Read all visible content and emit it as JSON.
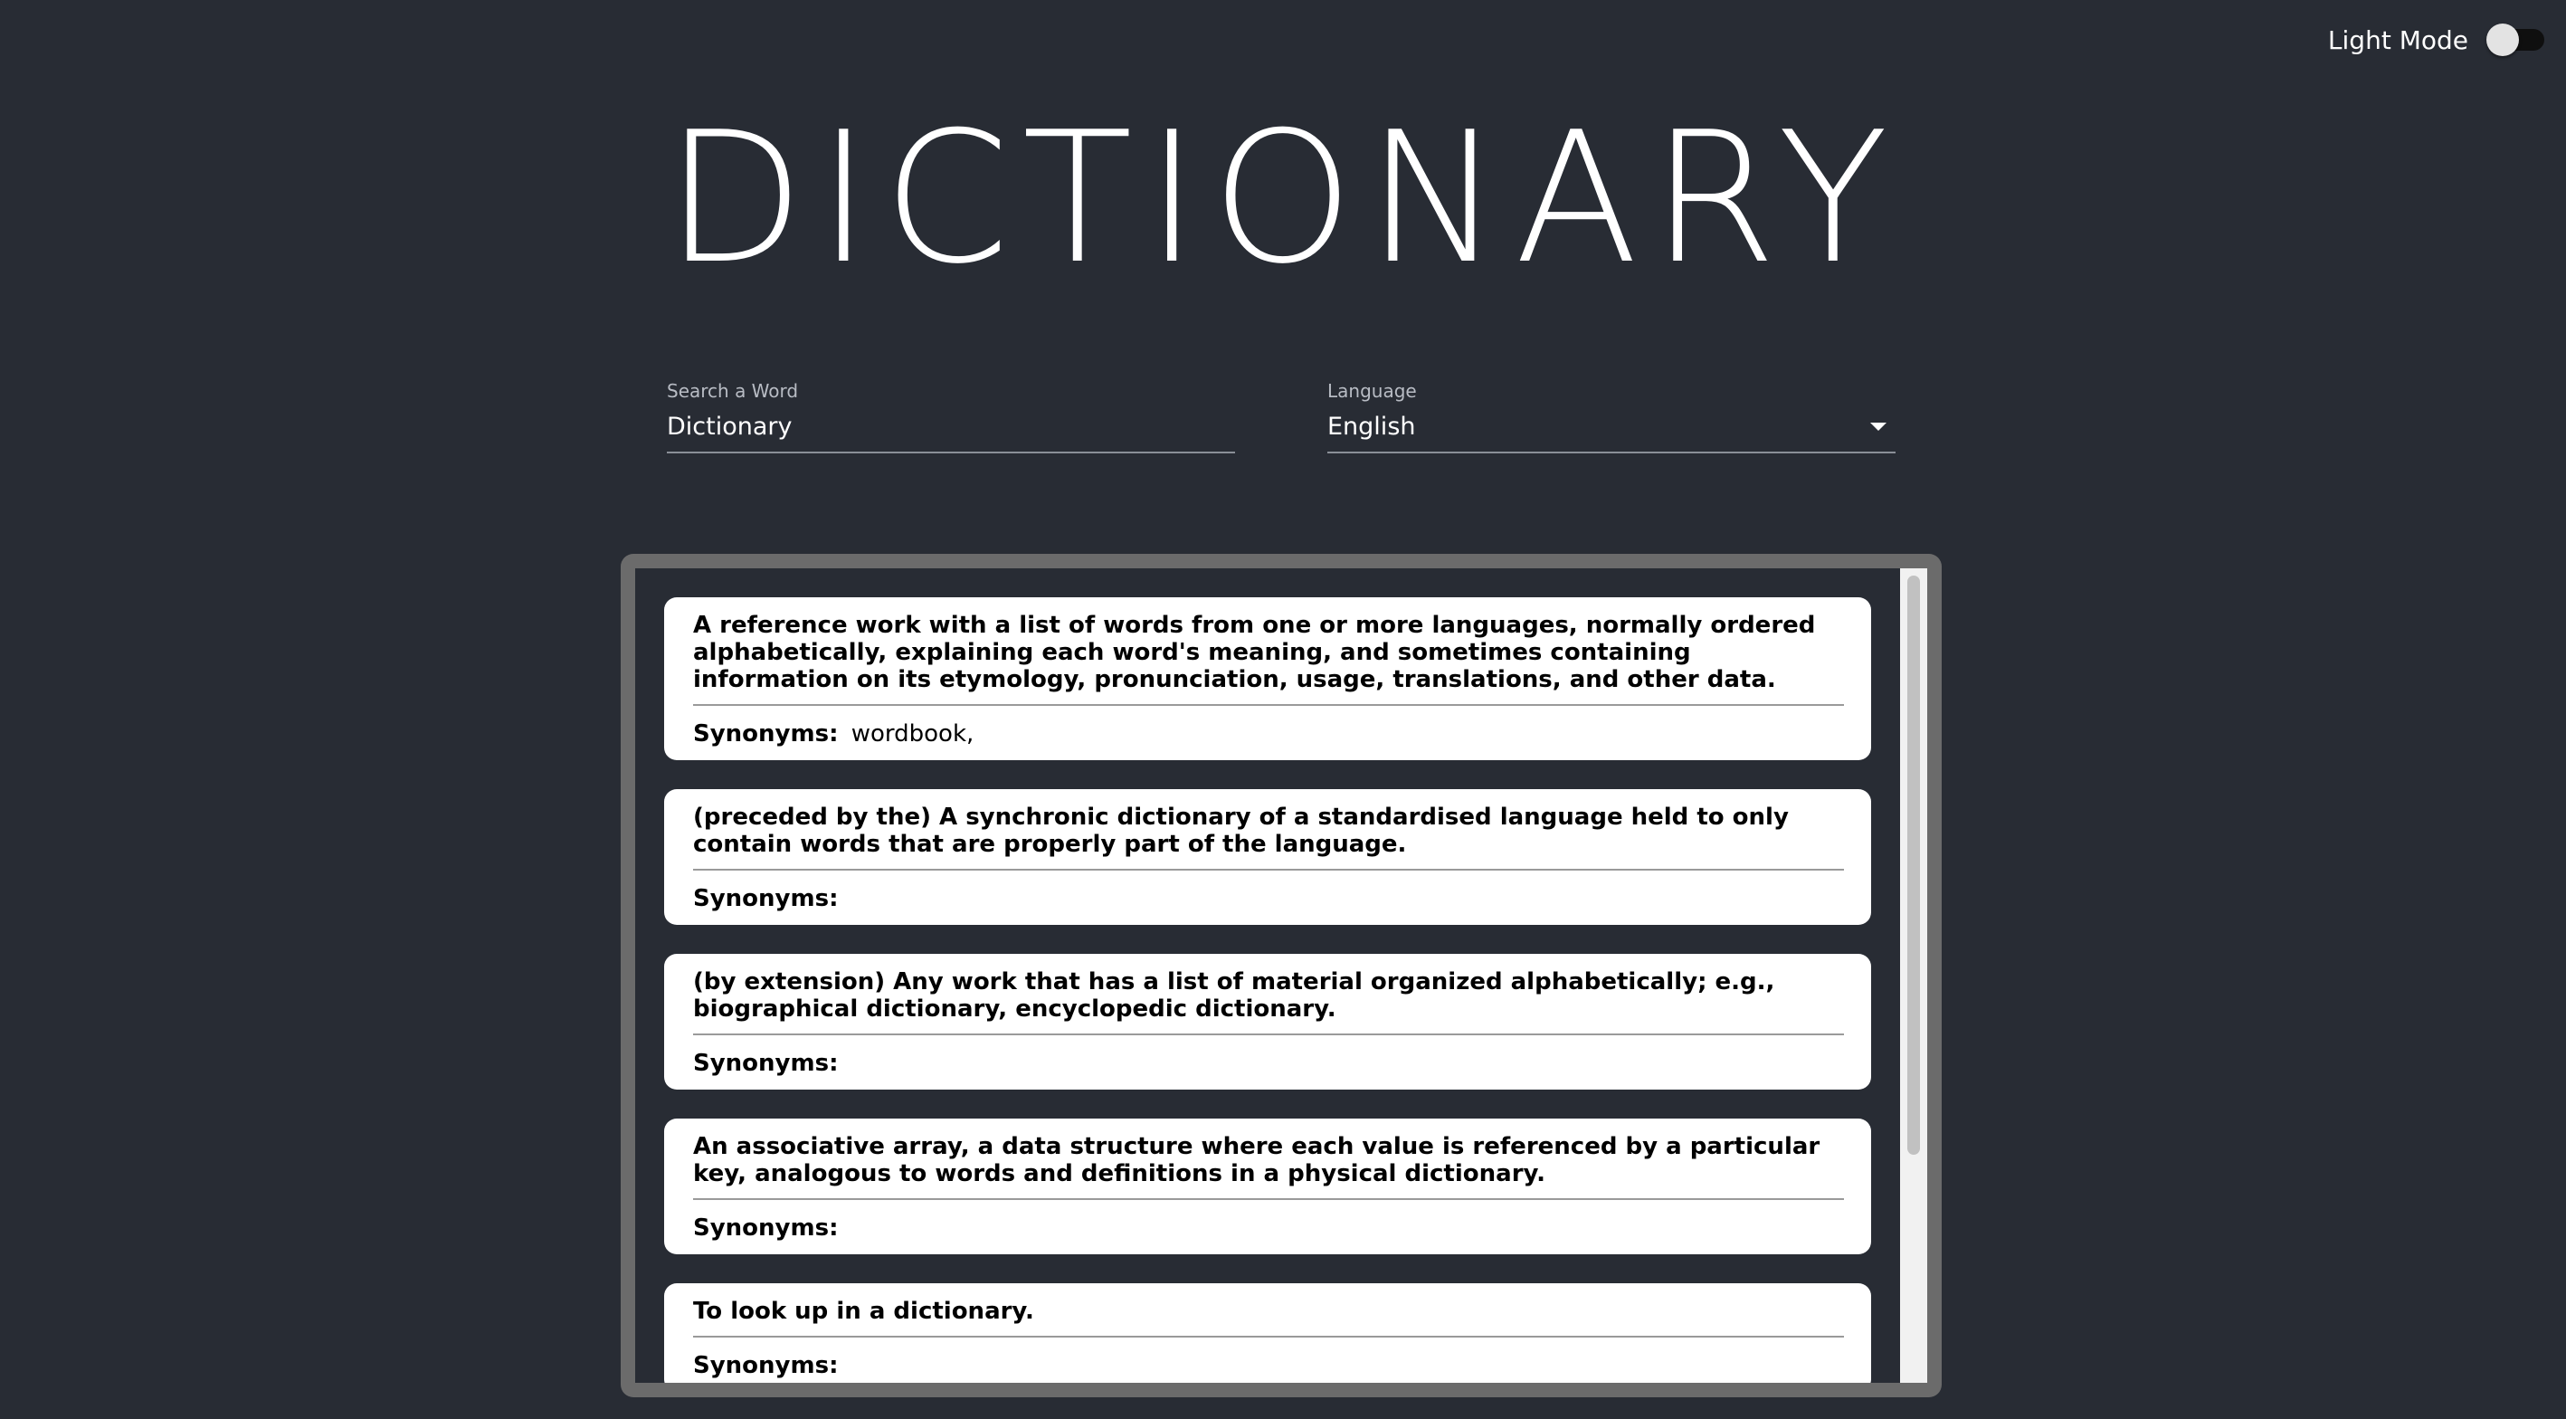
{
  "header": {
    "theme_toggle_label": "Light Mode",
    "title": "DICTIONARY"
  },
  "search": {
    "label": "Search a Word",
    "value": "Dictionary"
  },
  "language": {
    "label": "Language",
    "selected": "English"
  },
  "results": {
    "synonyms_label": "Synonyms:",
    "meanings": [
      {
        "definition": "A reference work with a list of words from one or more languages, normally ordered alphabetically, explaining each word's meaning, and sometimes containing information on its etymology, pronunciation, usage, translations, and other data.",
        "synonyms": "wordbook,"
      },
      {
        "definition": "(preceded by the) A synchronic dictionary of a standardised language held to only contain words that are properly part of the language.",
        "synonyms": ""
      },
      {
        "definition": "(by extension) Any work that has a list of material organized alphabetically; e.g., biographical dictionary, encyclopedic dictionary.",
        "synonyms": ""
      },
      {
        "definition": "An associative array, a data structure where each value is referenced by a particular key, analogous to words and definitions in a physical dictionary.",
        "synonyms": ""
      },
      {
        "definition": "To look up in a dictionary.",
        "synonyms": ""
      }
    ]
  },
  "colors": {
    "background": "#282c34",
    "frame": "#6b6b6b",
    "card": "#ffffff"
  },
  "icons": {
    "language_dropdown": "caret-down-icon"
  }
}
